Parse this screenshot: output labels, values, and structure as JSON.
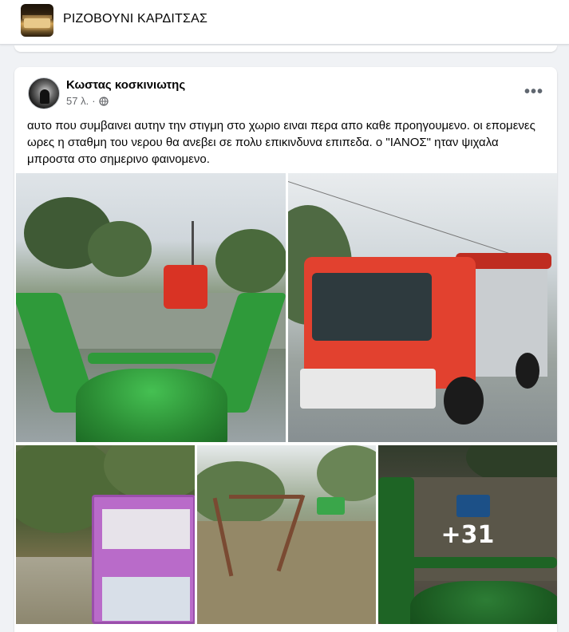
{
  "group": {
    "name": "ΡΙΖΟΒΟΥΝΙ ΚΑΡΔΙΤΣΑΣ"
  },
  "post": {
    "author": "Κωστας κοσκινιωτης",
    "time": "57 λ.",
    "separator": "·",
    "privacy_icon": "globe-icon",
    "menu_icon": "more-horizontal-icon",
    "text": "αυτο που συμβαινει αυτην την στιγμη στο χωριο ειναι περα απο καθε προηγουμενο. οι επομενες ωρες η σταθμη του νερου θα ανεβει σε πολυ επικινδυνα επιπεδα. ο \"ΙΑΝΟΣ\" ηταν ψιχαλα μπροστα στο σημερινο φαινομενο.",
    "photos": [
      {
        "desc": "tractor-loader-flooded-road"
      },
      {
        "desc": "fire-truck"
      },
      {
        "desc": "purple-kiosk-flood"
      },
      {
        "desc": "playground-flooded"
      },
      {
        "desc": "tractor-flood-more"
      }
    ],
    "more_photos": "+31"
  },
  "colors": {
    "page_bg": "#f0f2f5",
    "card_bg": "#ffffff",
    "muted": "#65676b"
  }
}
